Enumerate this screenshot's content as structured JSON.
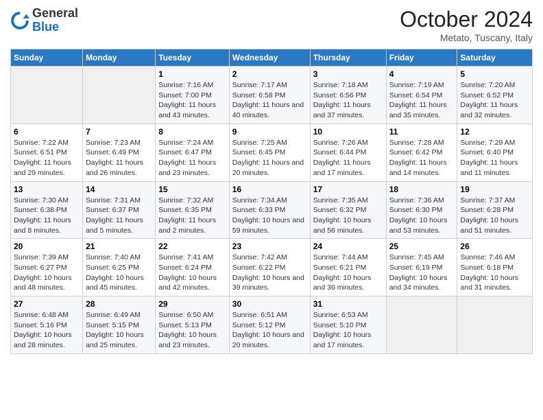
{
  "logo": {
    "general": "General",
    "blue": "Blue"
  },
  "header": {
    "title": "October 2024",
    "location": "Metato, Tuscany, Italy"
  },
  "columns": [
    "Sunday",
    "Monday",
    "Tuesday",
    "Wednesday",
    "Thursday",
    "Friday",
    "Saturday"
  ],
  "weeks": [
    [
      {
        "day": "",
        "sunrise": "",
        "sunset": "",
        "daylight": ""
      },
      {
        "day": "",
        "sunrise": "",
        "sunset": "",
        "daylight": ""
      },
      {
        "day": "1",
        "sunrise": "Sunrise: 7:16 AM",
        "sunset": "Sunset: 7:00 PM",
        "daylight": "Daylight: 11 hours and 43 minutes."
      },
      {
        "day": "2",
        "sunrise": "Sunrise: 7:17 AM",
        "sunset": "Sunset: 6:58 PM",
        "daylight": "Daylight: 11 hours and 40 minutes."
      },
      {
        "day": "3",
        "sunrise": "Sunrise: 7:18 AM",
        "sunset": "Sunset: 6:56 PM",
        "daylight": "Daylight: 11 hours and 37 minutes."
      },
      {
        "day": "4",
        "sunrise": "Sunrise: 7:19 AM",
        "sunset": "Sunset: 6:54 PM",
        "daylight": "Daylight: 11 hours and 35 minutes."
      },
      {
        "day": "5",
        "sunrise": "Sunrise: 7:20 AM",
        "sunset": "Sunset: 6:52 PM",
        "daylight": "Daylight: 11 hours and 32 minutes."
      }
    ],
    [
      {
        "day": "6",
        "sunrise": "Sunrise: 7:22 AM",
        "sunset": "Sunset: 6:51 PM",
        "daylight": "Daylight: 11 hours and 29 minutes."
      },
      {
        "day": "7",
        "sunrise": "Sunrise: 7:23 AM",
        "sunset": "Sunset: 6:49 PM",
        "daylight": "Daylight: 11 hours and 26 minutes."
      },
      {
        "day": "8",
        "sunrise": "Sunrise: 7:24 AM",
        "sunset": "Sunset: 6:47 PM",
        "daylight": "Daylight: 11 hours and 23 minutes."
      },
      {
        "day": "9",
        "sunrise": "Sunrise: 7:25 AM",
        "sunset": "Sunset: 6:45 PM",
        "daylight": "Daylight: 11 hours and 20 minutes."
      },
      {
        "day": "10",
        "sunrise": "Sunrise: 7:26 AM",
        "sunset": "Sunset: 6:44 PM",
        "daylight": "Daylight: 11 hours and 17 minutes."
      },
      {
        "day": "11",
        "sunrise": "Sunrise: 7:28 AM",
        "sunset": "Sunset: 6:42 PM",
        "daylight": "Daylight: 11 hours and 14 minutes."
      },
      {
        "day": "12",
        "sunrise": "Sunrise: 7:29 AM",
        "sunset": "Sunset: 6:40 PM",
        "daylight": "Daylight: 11 hours and 11 minutes."
      }
    ],
    [
      {
        "day": "13",
        "sunrise": "Sunrise: 7:30 AM",
        "sunset": "Sunset: 6:38 PM",
        "daylight": "Daylight: 11 hours and 8 minutes."
      },
      {
        "day": "14",
        "sunrise": "Sunrise: 7:31 AM",
        "sunset": "Sunset: 6:37 PM",
        "daylight": "Daylight: 11 hours and 5 minutes."
      },
      {
        "day": "15",
        "sunrise": "Sunrise: 7:32 AM",
        "sunset": "Sunset: 6:35 PM",
        "daylight": "Daylight: 11 hours and 2 minutes."
      },
      {
        "day": "16",
        "sunrise": "Sunrise: 7:34 AM",
        "sunset": "Sunset: 6:33 PM",
        "daylight": "Daylight: 10 hours and 59 minutes."
      },
      {
        "day": "17",
        "sunrise": "Sunrise: 7:35 AM",
        "sunset": "Sunset: 6:32 PM",
        "daylight": "Daylight: 10 hours and 56 minutes."
      },
      {
        "day": "18",
        "sunrise": "Sunrise: 7:36 AM",
        "sunset": "Sunset: 6:30 PM",
        "daylight": "Daylight: 10 hours and 53 minutes."
      },
      {
        "day": "19",
        "sunrise": "Sunrise: 7:37 AM",
        "sunset": "Sunset: 6:28 PM",
        "daylight": "Daylight: 10 hours and 51 minutes."
      }
    ],
    [
      {
        "day": "20",
        "sunrise": "Sunrise: 7:39 AM",
        "sunset": "Sunset: 6:27 PM",
        "daylight": "Daylight: 10 hours and 48 minutes."
      },
      {
        "day": "21",
        "sunrise": "Sunrise: 7:40 AM",
        "sunset": "Sunset: 6:25 PM",
        "daylight": "Daylight: 10 hours and 45 minutes."
      },
      {
        "day": "22",
        "sunrise": "Sunrise: 7:41 AM",
        "sunset": "Sunset: 6:24 PM",
        "daylight": "Daylight: 10 hours and 42 minutes."
      },
      {
        "day": "23",
        "sunrise": "Sunrise: 7:42 AM",
        "sunset": "Sunset: 6:22 PM",
        "daylight": "Daylight: 10 hours and 39 minutes."
      },
      {
        "day": "24",
        "sunrise": "Sunrise: 7:44 AM",
        "sunset": "Sunset: 6:21 PM",
        "daylight": "Daylight: 10 hours and 36 minutes."
      },
      {
        "day": "25",
        "sunrise": "Sunrise: 7:45 AM",
        "sunset": "Sunset: 6:19 PM",
        "daylight": "Daylight: 10 hours and 34 minutes."
      },
      {
        "day": "26",
        "sunrise": "Sunrise: 7:46 AM",
        "sunset": "Sunset: 6:18 PM",
        "daylight": "Daylight: 10 hours and 31 minutes."
      }
    ],
    [
      {
        "day": "27",
        "sunrise": "Sunrise: 6:48 AM",
        "sunset": "Sunset: 5:16 PM",
        "daylight": "Daylight: 10 hours and 28 minutes."
      },
      {
        "day": "28",
        "sunrise": "Sunrise: 6:49 AM",
        "sunset": "Sunset: 5:15 PM",
        "daylight": "Daylight: 10 hours and 25 minutes."
      },
      {
        "day": "29",
        "sunrise": "Sunrise: 6:50 AM",
        "sunset": "Sunset: 5:13 PM",
        "daylight": "Daylight: 10 hours and 23 minutes."
      },
      {
        "day": "30",
        "sunrise": "Sunrise: 6:51 AM",
        "sunset": "Sunset: 5:12 PM",
        "daylight": "Daylight: 10 hours and 20 minutes."
      },
      {
        "day": "31",
        "sunrise": "Sunrise: 6:53 AM",
        "sunset": "Sunset: 5:10 PM",
        "daylight": "Daylight: 10 hours and 17 minutes."
      },
      {
        "day": "",
        "sunrise": "",
        "sunset": "",
        "daylight": ""
      },
      {
        "day": "",
        "sunrise": "",
        "sunset": "",
        "daylight": ""
      }
    ]
  ]
}
